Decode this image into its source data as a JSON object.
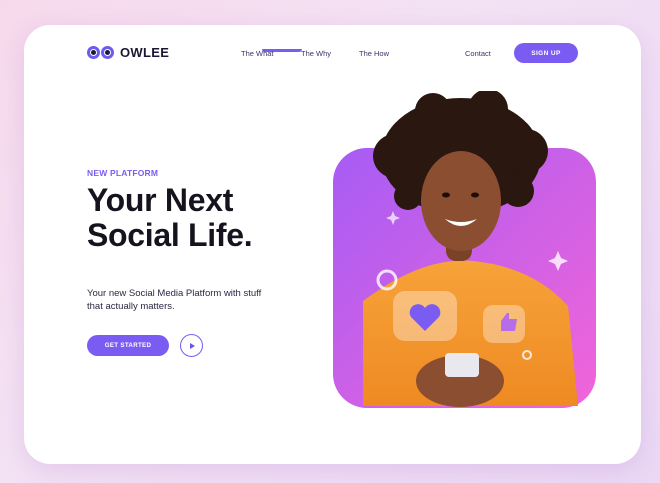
{
  "brand": {
    "name": "OWLEE"
  },
  "nav": {
    "items": [
      "The What",
      "The Why",
      "The How"
    ],
    "contact": "Contact",
    "signup": "SIGN UP"
  },
  "hero": {
    "eyebrow": "NEW PLATFORM",
    "headline_line1": "Your Next",
    "headline_line2": "Social Life.",
    "subtitle": "Your new Social Media Platform with stuff that actually matters.",
    "cta_label": "GET STARTED"
  },
  "icons": {
    "logo": "owl-eyes-icon",
    "play": "play-icon",
    "heart": "heart-icon",
    "like": "thumbs-up-icon"
  },
  "colors": {
    "accent": "#7b5cf2",
    "gradient_start": "#a65cf5",
    "gradient_end": "#f265d8",
    "text_dark": "#16131f"
  }
}
